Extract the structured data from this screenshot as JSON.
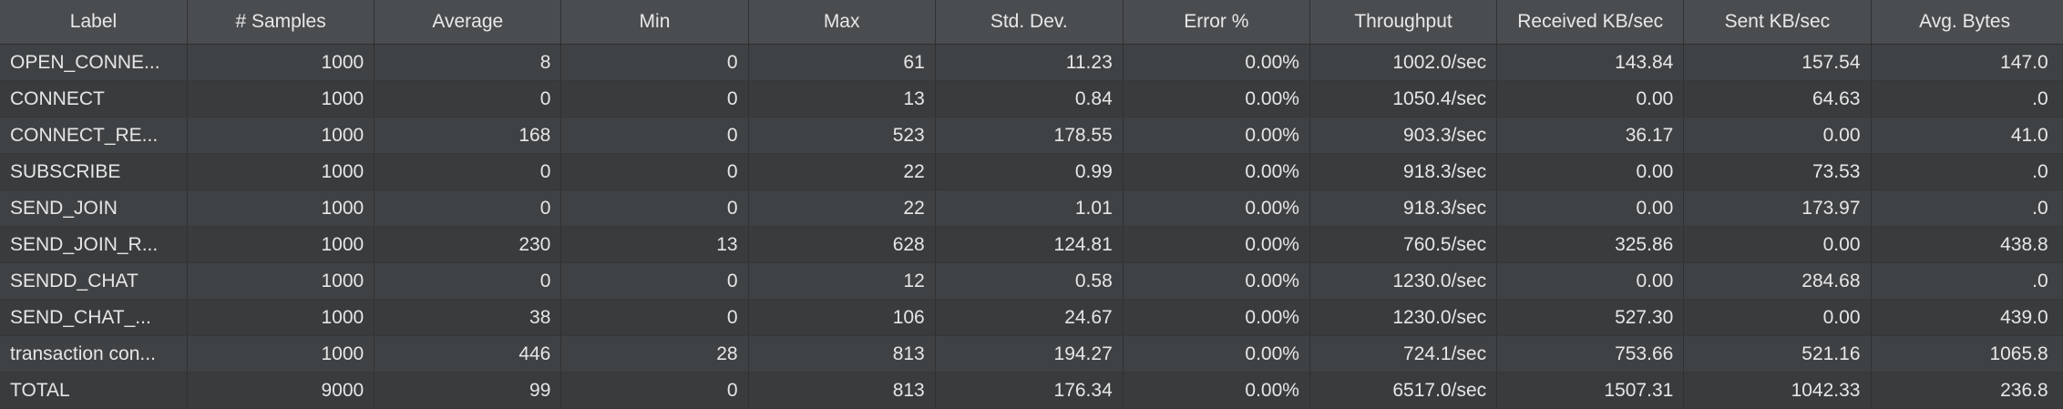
{
  "columns": [
    "Label",
    "# Samples",
    "Average",
    "Min",
    "Max",
    "Std. Dev.",
    "Error %",
    "Throughput",
    "Received KB/sec",
    "Sent KB/sec",
    "Avg. Bytes"
  ],
  "rows": [
    [
      "OPEN_CONNE...",
      "1000",
      "8",
      "0",
      "61",
      "11.23",
      "0.00%",
      "1002.0/sec",
      "143.84",
      "157.54",
      "147.0"
    ],
    [
      "CONNECT",
      "1000",
      "0",
      "0",
      "13",
      "0.84",
      "0.00%",
      "1050.4/sec",
      "0.00",
      "64.63",
      ".0"
    ],
    [
      "CONNECT_RE...",
      "1000",
      "168",
      "0",
      "523",
      "178.55",
      "0.00%",
      "903.3/sec",
      "36.17",
      "0.00",
      "41.0"
    ],
    [
      "SUBSCRIBE",
      "1000",
      "0",
      "0",
      "22",
      "0.99",
      "0.00%",
      "918.3/sec",
      "0.00",
      "73.53",
      ".0"
    ],
    [
      "SEND_JOIN",
      "1000",
      "0",
      "0",
      "22",
      "1.01",
      "0.00%",
      "918.3/sec",
      "0.00",
      "173.97",
      ".0"
    ],
    [
      "SEND_JOIN_R...",
      "1000",
      "230",
      "13",
      "628",
      "124.81",
      "0.00%",
      "760.5/sec",
      "325.86",
      "0.00",
      "438.8"
    ],
    [
      "SENDD_CHAT",
      "1000",
      "0",
      "0",
      "12",
      "0.58",
      "0.00%",
      "1230.0/sec",
      "0.00",
      "284.68",
      ".0"
    ],
    [
      "SEND_CHAT_...",
      "1000",
      "38",
      "0",
      "106",
      "24.67",
      "0.00%",
      "1230.0/sec",
      "527.30",
      "0.00",
      "439.0"
    ],
    [
      "transaction con...",
      "1000",
      "446",
      "28",
      "813",
      "194.27",
      "0.00%",
      "724.1/sec",
      "753.66",
      "521.16",
      "1065.8"
    ],
    [
      "TOTAL",
      "9000",
      "99",
      "0",
      "813",
      "176.34",
      "0.00%",
      "6517.0/sec",
      "1507.31",
      "1042.33",
      "236.8"
    ]
  ],
  "colors": {
    "background": "#3c3f41",
    "header_background": "#4a4d50",
    "row_odd": "#3f4244",
    "row_even": "#393b3d",
    "text": "#e6e6e6"
  }
}
